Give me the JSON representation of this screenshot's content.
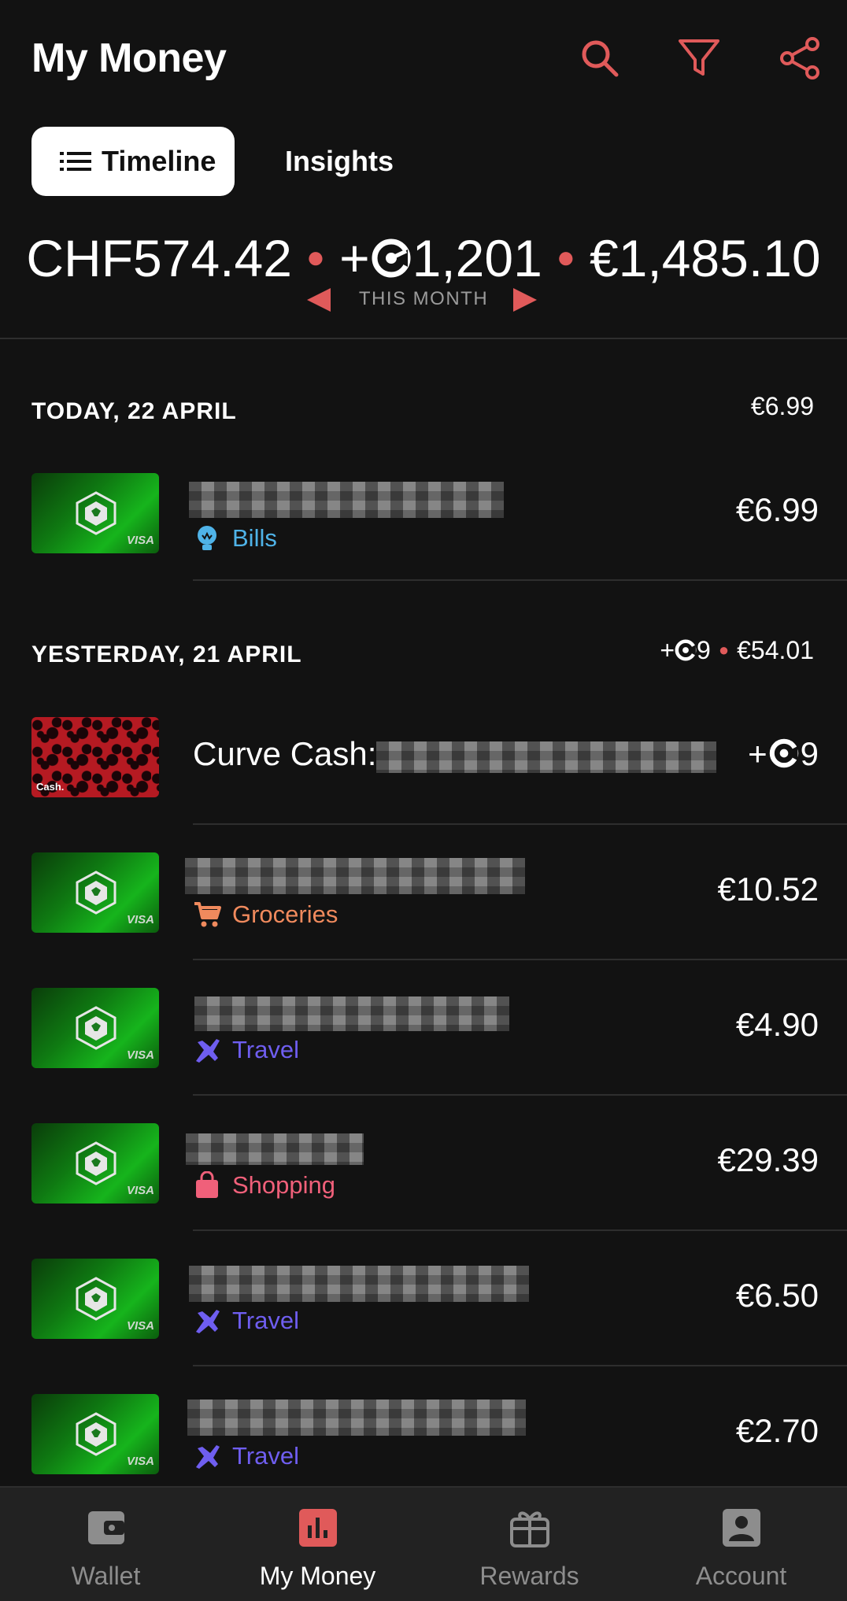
{
  "header": {
    "title": "My Money",
    "accent_color": "#e05a5a",
    "icons": [
      "search-icon",
      "filter-icon",
      "share-icon"
    ]
  },
  "tabs": [
    {
      "label": "Timeline",
      "active": true
    },
    {
      "label": "Insights",
      "active": false
    }
  ],
  "summary": {
    "chf": "CHF574.42",
    "cro_prefix": "+",
    "cro_value": "1,201",
    "eur": "€1,485.10",
    "period_label": "THIS MONTH"
  },
  "sections": [
    {
      "title": "TODAY, 22 APRIL",
      "total": "€6.99",
      "transactions": [
        {
          "card": "crypto-visa",
          "category": "Bills",
          "category_color": "#4fb3e8",
          "amount": "€6.99"
        }
      ]
    },
    {
      "title": "YESTERDAY, 21 APRIL",
      "total_cro": "+",
      "total_cro_value": "9",
      "total_eur": "€54.01",
      "transactions": [
        {
          "card": "curve-cash",
          "merchant": "Curve Cash:",
          "amount_prefix": "+",
          "amount_value": "9"
        },
        {
          "card": "crypto-visa",
          "category": "Groceries",
          "category_color": "#f08a5d",
          "amount": "€10.52"
        },
        {
          "card": "crypto-visa",
          "category": "Travel",
          "category_color": "#6f5ef0",
          "amount": "€4.90"
        },
        {
          "card": "crypto-visa",
          "category": "Shopping",
          "category_color": "#f0607a",
          "amount": "€29.39"
        },
        {
          "card": "crypto-visa",
          "category": "Travel",
          "category_color": "#6f5ef0",
          "amount": "€6.50"
        },
        {
          "card": "crypto-visa",
          "category": "Travel",
          "category_color": "#6f5ef0",
          "amount": "€2.70"
        }
      ]
    }
  ],
  "card_labels": {
    "visa": "VISA",
    "cash": "Cash."
  },
  "bottom_nav": [
    {
      "label": "Wallet",
      "icon": "wallet-icon",
      "active": false
    },
    {
      "label": "My Money",
      "icon": "chart-icon",
      "active": true
    },
    {
      "label": "Rewards",
      "icon": "gift-icon",
      "active": false
    },
    {
      "label": "Account",
      "icon": "account-icon",
      "active": false
    }
  ]
}
